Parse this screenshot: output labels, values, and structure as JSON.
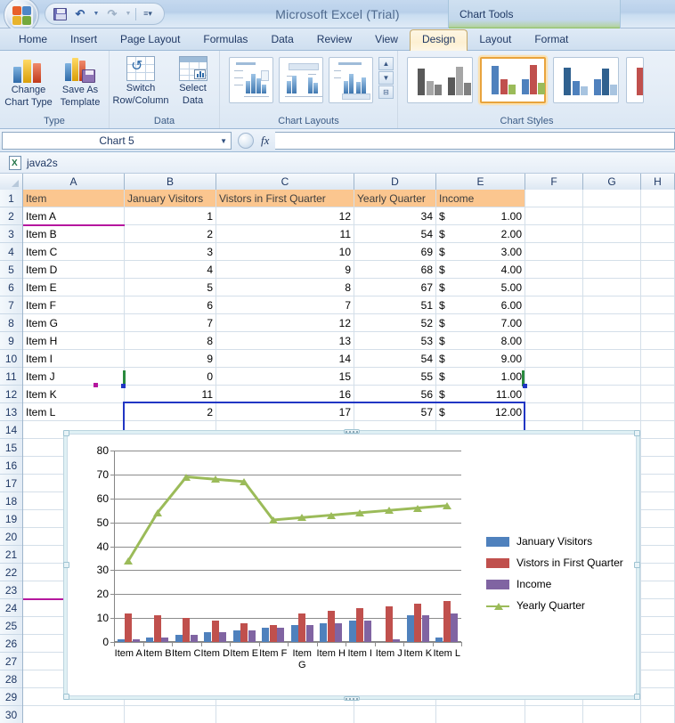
{
  "window": {
    "app_title": "Microsoft Excel (Trial)",
    "contextual_tools": "Chart Tools",
    "quick_access": [
      {
        "name": "save-icon",
        "tooltip": "Save"
      },
      {
        "name": "undo-icon",
        "tooltip": "Undo"
      },
      {
        "name": "redo-icon",
        "tooltip": "Redo"
      },
      {
        "name": "customize-qat-icon",
        "tooltip": "Customize Quick Access Toolbar"
      }
    ]
  },
  "tabs": [
    {
      "label": "Home",
      "active": false
    },
    {
      "label": "Insert",
      "active": false
    },
    {
      "label": "Page Layout",
      "active": false
    },
    {
      "label": "Formulas",
      "active": false
    },
    {
      "label": "Data",
      "active": false
    },
    {
      "label": "Review",
      "active": false
    },
    {
      "label": "View",
      "active": false
    },
    {
      "label": "Design",
      "active": true
    },
    {
      "label": "Layout",
      "active": false
    },
    {
      "label": "Format",
      "active": false
    }
  ],
  "ribbon": {
    "groups": [
      {
        "name": "Type",
        "buttons": [
          {
            "label_line1": "Change",
            "label_line2": "Chart Type",
            "icon": "column-chart-icon"
          },
          {
            "label_line1": "Save As",
            "label_line2": "Template",
            "icon": "save-template-icon"
          }
        ]
      },
      {
        "name": "Data",
        "buttons": [
          {
            "label_line1": "Switch",
            "label_line2": "Row/Column",
            "icon": "switch-row-column-icon"
          },
          {
            "label_line1": "Select",
            "label_line2": "Data",
            "icon": "select-data-icon"
          }
        ]
      },
      {
        "name": "Chart Layouts",
        "gallery_items": [
          "layout-1",
          "layout-2",
          "layout-3"
        ],
        "scroll_buttons": [
          "scroll-up",
          "scroll-down",
          "more-chart-layouts"
        ]
      },
      {
        "name": "Chart Styles",
        "gallery_items": [
          "style-grey",
          "style-color-selected",
          "style-blue",
          "style-red"
        ],
        "selected_index": 1
      }
    ]
  },
  "formula_bar": {
    "name_box_value": "Chart 5",
    "formula_value": "",
    "fx_label": "fx"
  },
  "sheet": {
    "document_name": "java2s",
    "column_headers": [
      "A",
      "B",
      "C",
      "D",
      "E",
      "F",
      "G",
      "H"
    ],
    "row_numbers": [
      1,
      2,
      3,
      4,
      5,
      6,
      7,
      8,
      9,
      10,
      11,
      12,
      13,
      14,
      15,
      16,
      17,
      18,
      19,
      20,
      21,
      22,
      23,
      24,
      25,
      26,
      27,
      28,
      29,
      30
    ],
    "header_row": [
      "Item",
      "January Visitors",
      "Vistors in First Quarter",
      "Yearly Quarter",
      "Income"
    ],
    "rows": [
      {
        "item": "Item A",
        "january": "1",
        "first_quarter": "12",
        "yearly": "34",
        "currency": "$",
        "income": "1.00"
      },
      {
        "item": "Item B",
        "january": "2",
        "first_quarter": "11",
        "yearly": "54",
        "currency": "$",
        "income": "2.00"
      },
      {
        "item": "Item C",
        "january": "3",
        "first_quarter": "10",
        "yearly": "69",
        "currency": "$",
        "income": "3.00"
      },
      {
        "item": "Item D",
        "january": "4",
        "first_quarter": "9",
        "yearly": "68",
        "currency": "$",
        "income": "4.00"
      },
      {
        "item": "Item E",
        "january": "5",
        "first_quarter": "8",
        "yearly": "67",
        "currency": "$",
        "income": "5.00"
      },
      {
        "item": "Item F",
        "january": "6",
        "first_quarter": "7",
        "yearly": "51",
        "currency": "$",
        "income": "6.00"
      },
      {
        "item": "Item G",
        "january": "7",
        "first_quarter": "12",
        "yearly": "52",
        "currency": "$",
        "income": "7.00"
      },
      {
        "item": "Item H",
        "january": "8",
        "first_quarter": "13",
        "yearly": "53",
        "currency": "$",
        "income": "8.00"
      },
      {
        "item": "Item I",
        "january": "9",
        "first_quarter": "14",
        "yearly": "54",
        "currency": "$",
        "income": "9.00"
      },
      {
        "item": "Item J",
        "january": "0",
        "first_quarter": "15",
        "yearly": "55",
        "currency": "$",
        "income": "1.00"
      },
      {
        "item": "Item K",
        "january": "11",
        "first_quarter": "16",
        "yearly": "56",
        "currency": "$",
        "income": "11.00"
      },
      {
        "item": "Item L",
        "january": "2",
        "first_quarter": "17",
        "yearly": "57",
        "currency": "$",
        "income": "12.00"
      }
    ]
  },
  "chart_data": {
    "type": "bar",
    "title": "",
    "xlabel": "",
    "ylabel": "",
    "ylim": [
      0,
      80
    ],
    "yticks": [
      0,
      10,
      20,
      30,
      40,
      50,
      60,
      70,
      80
    ],
    "grid": true,
    "legend_position": "right",
    "categories": [
      "Item A",
      "Item B",
      "Item C",
      "Item D",
      "Item E",
      "Item F",
      "Item G",
      "Item H",
      "Item I",
      "Item J",
      "Item K",
      "Item L"
    ],
    "series": [
      {
        "name": "January Visitors",
        "type": "bar",
        "color": "#4f81bd",
        "values": [
          1,
          2,
          3,
          4,
          5,
          6,
          7,
          8,
          9,
          0,
          11,
          2
        ]
      },
      {
        "name": "Vistors in First Quarter",
        "type": "bar",
        "color": "#c0504d",
        "values": [
          12,
          11,
          10,
          9,
          8,
          7,
          12,
          13,
          14,
          15,
          16,
          17
        ]
      },
      {
        "name": "Income",
        "type": "bar",
        "color": "#8064a2",
        "values": [
          1,
          2,
          3,
          4,
          5,
          6,
          7,
          8,
          9,
          1,
          11,
          12
        ]
      },
      {
        "name": "Yearly Quarter",
        "type": "line",
        "color": "#9bbb59",
        "values": [
          34,
          54,
          69,
          68,
          67,
          51,
          52,
          53,
          54,
          55,
          56,
          57
        ]
      }
    ]
  },
  "colors": {
    "header_fill": "#fbc68f",
    "selection_blue": "#2136c4",
    "selection_magenta": "#b5179e",
    "selection_green": "#2a8a3e",
    "series_blue": "#4f81bd",
    "series_red": "#c0504d",
    "series_purple": "#8064a2",
    "series_green": "#9bbb59"
  }
}
